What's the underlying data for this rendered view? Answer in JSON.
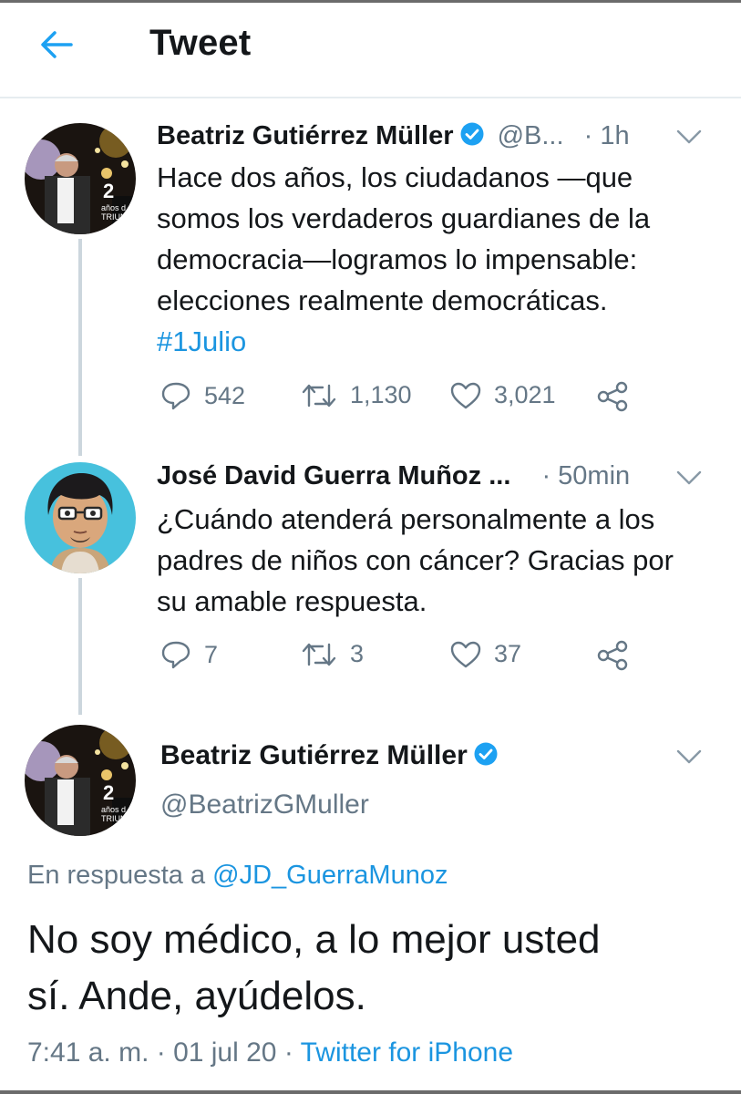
{
  "header": {
    "title": "Tweet"
  },
  "tweet1": {
    "name": "Beatriz Gutiérrez Müller",
    "handle": "@B...",
    "time": "· 1h",
    "lines": [
      "Hace dos años, los ciudadanos —que",
      "somos los verdaderos guardianes de la",
      "democracia—logramos lo impensable:",
      "elecciones realmente democráticas."
    ],
    "hashtag": "#1Julio",
    "replies": "542",
    "retweets": "1,130",
    "likes": "3,021",
    "avatar_badge": "2",
    "avatar_caption": "años d TRIUN"
  },
  "tweet2": {
    "name": "José David Guerra Muñoz ...",
    "time": "· 50min",
    "lines": [
      "¿Cuándo atenderá personalmente a los",
      "padres de niños con cáncer? Gracias por",
      "su amable respuesta."
    ],
    "replies": "7",
    "retweets": "3",
    "likes": "37"
  },
  "tweet3": {
    "name": "Beatriz Gutiérrez Müller",
    "handle": "@BeatrizGMuller",
    "reply_prefix": "En respuesta a ",
    "reply_to": "@JD_GuerraMunoz",
    "lines": [
      "No soy médico, a lo mejor usted",
      "sí. Ande, ayúdelos."
    ],
    "timestamp": "7:41 a. m. · 01 jul 20 · ",
    "source": "Twitter for iPhone",
    "avatar_badge": "2",
    "avatar_caption": "años d TRIUN"
  },
  "colors": {
    "accent": "#1b95e0",
    "muted": "#657786",
    "text": "#14171a",
    "verified": "#1da1f2"
  }
}
